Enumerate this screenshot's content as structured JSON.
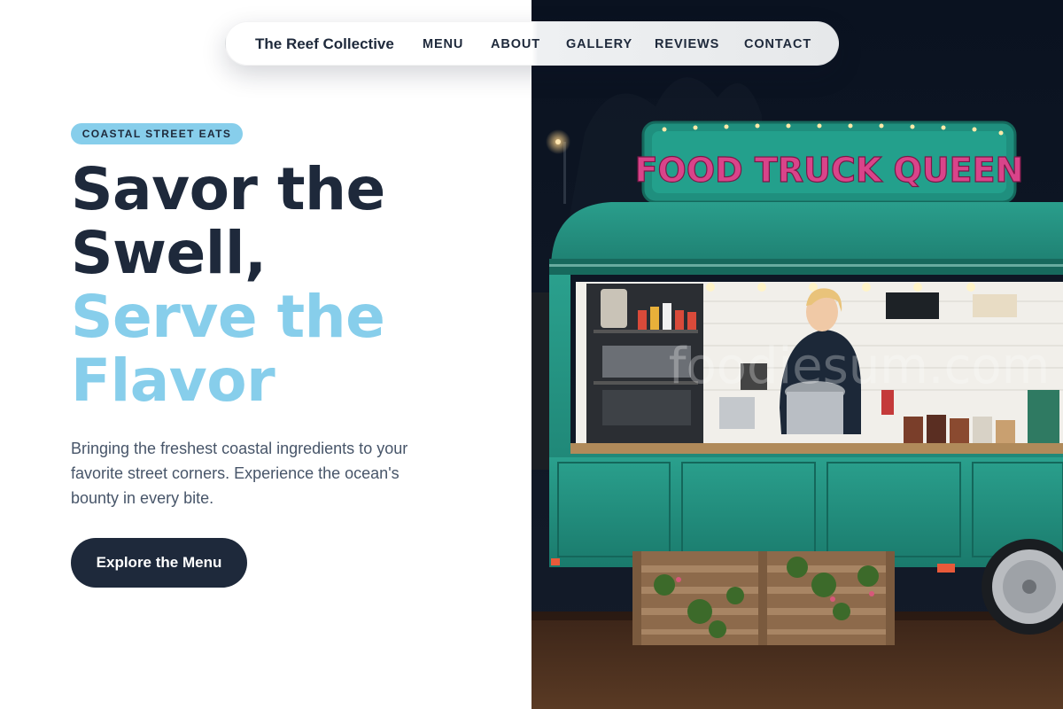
{
  "nav": {
    "brand": "The Reef Collective",
    "links": [
      "MENU",
      "ABOUT",
      "GALLERY",
      "REVIEWS",
      "CONTACT"
    ]
  },
  "hero": {
    "badge": "COASTAL STREET EATS",
    "headline_lines": [
      "Savor the",
      "Swell,"
    ],
    "headline_accent_lines": [
      "Serve the",
      "Flavor"
    ],
    "description_lines": [
      "Bringing the freshest coastal ingredients to your",
      "favorite street corners. Experience the ocean's",
      "bounty in every bite."
    ],
    "cta_label": "Explore the Menu",
    "image": {
      "subject": "food-truck-photo",
      "sign_text": "FOOD TRUCK QUEEN",
      "watermark_text": "foodiesum.com"
    }
  },
  "colors": {
    "text_dark": "#1e293b",
    "accent_light_blue": "#87ceeb",
    "body_text": "#475569",
    "truck_teal": "#1f9a88",
    "sign_pink": "#d9448a"
  }
}
